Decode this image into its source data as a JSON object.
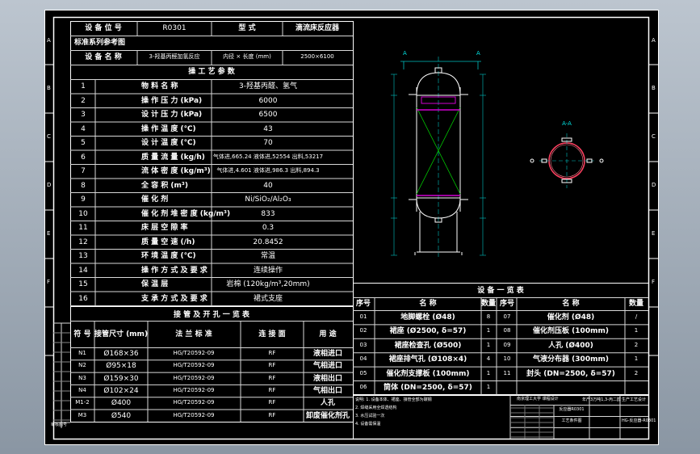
{
  "sheet": {
    "border_letters_left": [
      "A",
      "B",
      "C",
      "D",
      "E",
      "F"
    ],
    "border_letters_right": [
      "A",
      "B",
      "C",
      "D",
      "E",
      "F"
    ]
  },
  "spec": {
    "row0": {
      "label": "设 备 位 号",
      "value": "R0301",
      "type_label": "型  式",
      "type_value": "滴流床反应器"
    },
    "row_std": {
      "label": "标准系列参考图"
    },
    "row_name": {
      "label": "设 备 名 称",
      "value": "3-羟基丙醛加氢反应",
      "dim_label": "内径 × 长度 (mm)",
      "dim_value": "2500×6100"
    },
    "title": "操 工 艺 参 数",
    "rows": [
      {
        "no": "1",
        "name": "物 料 名 称",
        "value": "3-羟基丙醛、氢气"
      },
      {
        "no": "2",
        "name": "操 作 压 力 (kPa)",
        "value": "6000"
      },
      {
        "no": "3",
        "name": "设 计 压 力 (kPa)",
        "value": "6500"
      },
      {
        "no": "4",
        "name": "操 作 温 度 (℃)",
        "value": "43"
      },
      {
        "no": "5",
        "name": "设 计 温 度 (℃)",
        "value": "70"
      },
      {
        "no": "6",
        "name": "质 量 流 量 (kg/h)",
        "value": "气体进,665.24 液体进,52554 出料,53217"
      },
      {
        "no": "7",
        "name": "流 体 密 度 (kg/m³)",
        "value": "气体进,4.601 液体进,986.3 出料,894.3"
      },
      {
        "no": "8",
        "name": "全 容 积 (m³)",
        "value": "40"
      },
      {
        "no": "9",
        "name": "催 化 剂",
        "value": "Ni/SiO₂/Al₂O₃"
      },
      {
        "no": "10",
        "name": "催 化 剂 堆 密 度 (kg/m³)",
        "value": "833"
      },
      {
        "no": "11",
        "name": "床 层 空 隙 率",
        "value": "0.3"
      },
      {
        "no": "12",
        "name": "质 量 空 速 (/h)",
        "value": "20.8452"
      },
      {
        "no": "13",
        "name": "环 境 温 度 (℃)",
        "value": "常温"
      },
      {
        "no": "14",
        "name": "操 作 方 式 及 要 求",
        "value": "连续操作"
      },
      {
        "no": "15",
        "name": "保 温 层",
        "value": "岩棉 (120kg/m³,20mm)"
      },
      {
        "no": "16",
        "name": "支 承 方 式 及 要 求",
        "value": "裙式支座"
      }
    ]
  },
  "nozzles": {
    "title": "接 管 及 开 孔 一 览 表",
    "headers": [
      "符 号",
      "接管尺寸 (mm)",
      "法 兰 标 准",
      "连 接 面",
      "用  途"
    ],
    "rows": [
      {
        "sym": "N1",
        "size": "Ø168×36",
        "std": "HG/T20592-09",
        "face": "RF",
        "use": "液相进口"
      },
      {
        "sym": "N2",
        "size": "Ø95×18",
        "std": "HG/T20592-09",
        "face": "RF",
        "use": "气相进口"
      },
      {
        "sym": "N3",
        "size": "Ø159×30",
        "std": "HG/T20592-09",
        "face": "RF",
        "use": "液相出口"
      },
      {
        "sym": "N4",
        "size": "Ø102×24",
        "std": "HG/T20592-09",
        "face": "RF",
        "use": "气相出口"
      },
      {
        "sym": "M1-2",
        "size": "Ø400",
        "std": "HG/T20592-09",
        "face": "RF",
        "use": "人孔"
      },
      {
        "sym": "M3",
        "size": "Ø540",
        "std": "HG/T20592-09",
        "face": "RF",
        "use": "卸废催化剂孔"
      }
    ],
    "stamp": "审核图号"
  },
  "equipment": {
    "title": "设 备 一 览 表",
    "headers": [
      "序号",
      "名  称",
      "数量",
      "序号",
      "名  称",
      "数量"
    ],
    "rows": [
      {
        "n1": "01",
        "name1": "地脚螺栓 (Ø48)",
        "q1": "8",
        "n2": "07",
        "name2": "催化剂 (Ø48)",
        "q2": "/"
      },
      {
        "n1": "02",
        "name1": "裙座 (Ø2500, δ=57)",
        "q1": "1",
        "n2": "08",
        "name2": "催化剂压板 (100mm)",
        "q2": "1"
      },
      {
        "n1": "03",
        "name1": "裙座检查孔 (Ø500)",
        "q1": "1",
        "n2": "09",
        "name2": "人孔 (Ø400)",
        "q2": "2"
      },
      {
        "n1": "04",
        "name1": "裙座排气孔 (Ø108×4)",
        "q1": "4",
        "n2": "10",
        "name2": "气液分布器 (300mm)",
        "q2": "1"
      },
      {
        "n1": "05",
        "name1": "催化剂支撑板 (100mm)",
        "q1": "1",
        "n2": "11",
        "name2": "封头 (DN=2500, δ=57)",
        "q2": "2"
      },
      {
        "n1": "06",
        "name1": "筒体 (DN=2500, δ=57)",
        "q1": "1",
        "n2": "",
        "name2": "",
        "q2": ""
      }
    ]
  },
  "notes": {
    "lines": [
      "说明: 1. 设备本体、裙座、接管全部为碳钢",
      "2. 焊缝采用全焊透结构",
      "3. 水压试验一次",
      "4. 设备需保温"
    ]
  },
  "title_block": {
    "school": "南京理工大学  课程设计",
    "drawing": "反应器R0301",
    "drawing2": "工艺条件图",
    "company": "年产3万吨1,3-丙二醇",
    "company2": "生产工艺设计",
    "number": "HG-反应器-R0301"
  },
  "drawing": {
    "section_label": "A-A",
    "cut_label": "A"
  }
}
